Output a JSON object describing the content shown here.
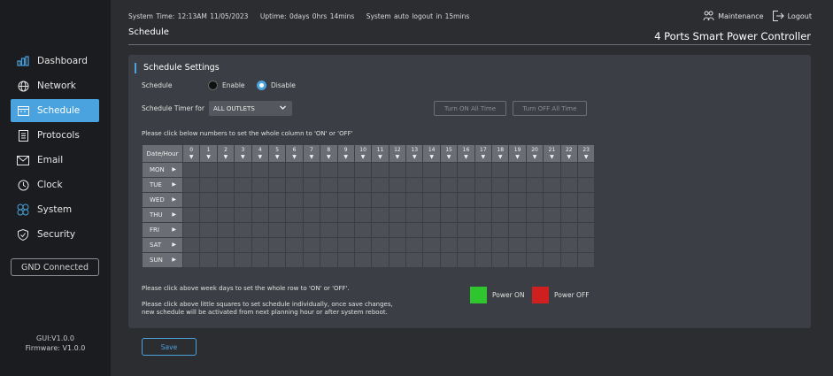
{
  "status": {
    "system_time": "System Time: 12:13AM 11/05/2023",
    "uptime": "Uptime: 0days 0hrs 14mins",
    "auto_logout": "System auto logout in 15mins"
  },
  "header": {
    "page_title": "Schedule",
    "product": "4 Ports Smart Power Controller",
    "maintenance": "Maintenance",
    "logout": "Logout"
  },
  "sidebar": {
    "items": [
      {
        "label": "Dashboard",
        "icon": "dashboard-icon"
      },
      {
        "label": "Network",
        "icon": "globe-icon"
      },
      {
        "label": "Schedule",
        "icon": "calendar-icon"
      },
      {
        "label": "Protocols",
        "icon": "document-icon"
      },
      {
        "label": "Email",
        "icon": "mail-icon"
      },
      {
        "label": "Clock",
        "icon": "clock-icon"
      },
      {
        "label": "System",
        "icon": "system-icon"
      },
      {
        "label": "Security",
        "icon": "shield-icon"
      }
    ],
    "active_index": 2,
    "gnd_status": "GND Connected",
    "gui_version": "GUI:V1.0.0",
    "firmware": "Firmware: V1.0.0"
  },
  "schedule": {
    "section_title": "Schedule Settings",
    "schedule_label": "Schedule",
    "enable_label": "Enable",
    "disable_label": "Disable",
    "selected": "Disable",
    "timer_for_label": "Schedule Timer for",
    "timer_for_value": "ALL OUTLETS",
    "turn_on_all": "Turn ON All Time",
    "turn_off_all": "Turn OFF All Time",
    "column_hint": "Please click below numbers to set the whole column to 'ON' or 'OFF'",
    "grid_header": "Date/Hour",
    "hours": [
      "0",
      "1",
      "2",
      "3",
      "4",
      "5",
      "6",
      "7",
      "8",
      "9",
      "10",
      "11",
      "12",
      "13",
      "14",
      "15",
      "16",
      "17",
      "18",
      "19",
      "20",
      "21",
      "22",
      "23"
    ],
    "days": [
      "MON",
      "TUE",
      "WED",
      "THU",
      "FRI",
      "SAT",
      "SUN"
    ],
    "row_hint": "Please click above week days to set the whole row to 'ON' or 'OFF'.",
    "cell_hint_1": "Please click above little squares to set schedule individually, once save changes,",
    "cell_hint_2": "new schedule will be activated from next planning hour or after system reboot.",
    "legend_on": "Power ON",
    "legend_off": "Power OFF",
    "legend_on_color": "#2ec52e",
    "legend_off_color": "#d01f1f",
    "save_label": "Save"
  },
  "colors": {
    "accent": "#4aa3df",
    "cell": "#4c4f55"
  }
}
